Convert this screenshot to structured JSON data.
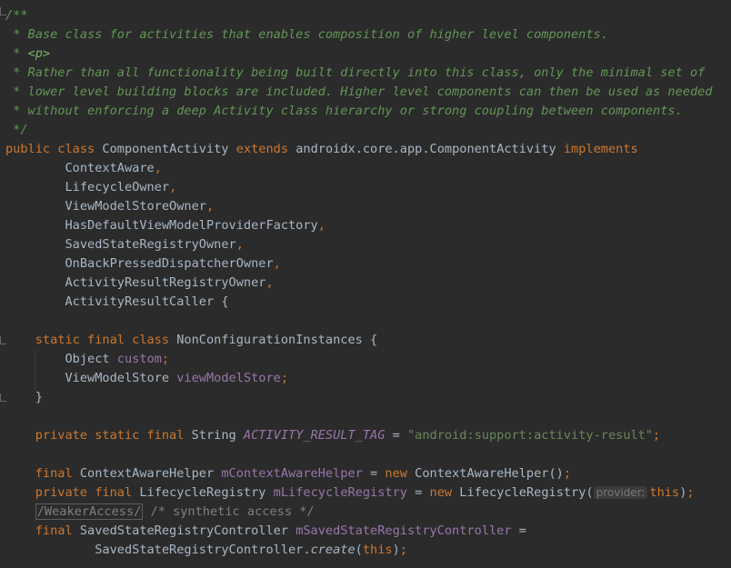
{
  "lines": [
    {
      "n": 0,
      "parts": [
        {
          "c": "doc",
          "t": "/**"
        }
      ]
    },
    {
      "n": 1,
      "parts": [
        {
          "c": "doc",
          "t": " * Base class for activities that enables composition of higher level components."
        }
      ]
    },
    {
      "n": 2,
      "parts": [
        {
          "c": "doc",
          "t": " * "
        },
        {
          "c": "doctag",
          "t": "<p>"
        }
      ]
    },
    {
      "n": 3,
      "parts": [
        {
          "c": "doc",
          "t": " * Rather than all functionality being built directly into this class, only the minimal set of"
        }
      ]
    },
    {
      "n": 4,
      "parts": [
        {
          "c": "doc",
          "t": " * lower level building blocks are included. Higher level components can then be used as needed"
        }
      ]
    },
    {
      "n": 5,
      "parts": [
        {
          "c": "doc",
          "t": " * without enforcing a deep Activity class hierarchy or strong coupling between components."
        }
      ]
    },
    {
      "n": 6,
      "parts": [
        {
          "c": "doc",
          "t": " */"
        }
      ]
    },
    {
      "n": 7,
      "parts": [
        {
          "c": "kw",
          "t": "public class "
        },
        {
          "c": "plain",
          "t": "ComponentActivity "
        },
        {
          "c": "kw",
          "t": "extends "
        },
        {
          "c": "plain",
          "t": "androidx.core.app.ComponentActivity "
        },
        {
          "c": "kw",
          "t": "implements"
        }
      ]
    },
    {
      "n": 8,
      "parts": [
        {
          "c": "plain",
          "t": "        ContextAware"
        },
        {
          "c": "kw",
          "t": ","
        }
      ]
    },
    {
      "n": 9,
      "parts": [
        {
          "c": "plain",
          "t": "        LifecycleOwner"
        },
        {
          "c": "kw",
          "t": ","
        }
      ]
    },
    {
      "n": 10,
      "parts": [
        {
          "c": "plain",
          "t": "        ViewModelStoreOwner"
        },
        {
          "c": "kw",
          "t": ","
        }
      ]
    },
    {
      "n": 11,
      "parts": [
        {
          "c": "plain",
          "t": "        HasDefaultViewModelProviderFactory"
        },
        {
          "c": "kw",
          "t": ","
        }
      ]
    },
    {
      "n": 12,
      "parts": [
        {
          "c": "plain",
          "t": "        SavedStateRegistryOwner"
        },
        {
          "c": "kw",
          "t": ","
        }
      ]
    },
    {
      "n": 13,
      "parts": [
        {
          "c": "plain",
          "t": "        OnBackPressedDispatcherOwner"
        },
        {
          "c": "kw",
          "t": ","
        }
      ]
    },
    {
      "n": 14,
      "parts": [
        {
          "c": "plain",
          "t": "        ActivityResultRegistryOwner"
        },
        {
          "c": "kw",
          "t": ","
        }
      ]
    },
    {
      "n": 15,
      "parts": [
        {
          "c": "plain",
          "t": "        ActivityResultCaller {"
        }
      ]
    },
    {
      "n": 16,
      "parts": []
    },
    {
      "n": 17,
      "parts": [
        {
          "c": "kw",
          "t": "    static final class "
        },
        {
          "c": "plain",
          "t": "NonConfigurationInstances {"
        }
      ]
    },
    {
      "n": 18,
      "parts": [
        {
          "c": "plain",
          "t": "        Object "
        },
        {
          "c": "field",
          "t": "custom"
        },
        {
          "c": "kw",
          "t": ";"
        }
      ]
    },
    {
      "n": 19,
      "parts": [
        {
          "c": "plain",
          "t": "        ViewModelStore "
        },
        {
          "c": "field",
          "t": "viewModelStore"
        },
        {
          "c": "kw",
          "t": ";"
        }
      ]
    },
    {
      "n": 20,
      "parts": [
        {
          "c": "plain",
          "t": "    }"
        }
      ]
    },
    {
      "n": 21,
      "parts": []
    },
    {
      "n": 22,
      "parts": [
        {
          "c": "kw",
          "t": "    private static final "
        },
        {
          "c": "plain",
          "t": "String "
        },
        {
          "c": "cfield",
          "t": "ACTIVITY_RESULT_TAG"
        },
        {
          "c": "plain",
          "t": " = "
        },
        {
          "c": "str",
          "t": "\"android:support:activity-result\""
        },
        {
          "c": "kw",
          "t": ";"
        }
      ]
    },
    {
      "n": 23,
      "parts": []
    },
    {
      "n": 24,
      "parts": [
        {
          "c": "kw",
          "t": "    final "
        },
        {
          "c": "plain",
          "t": "ContextAwareHelper "
        },
        {
          "c": "field",
          "t": "mContextAwareHelper"
        },
        {
          "c": "plain",
          "t": " = "
        },
        {
          "c": "kw",
          "t": "new "
        },
        {
          "c": "plain",
          "t": "ContextAwareHelper()"
        },
        {
          "c": "kw",
          "t": ";"
        }
      ]
    },
    {
      "n": 25,
      "parts": [
        {
          "c": "kw",
          "t": "    private final "
        },
        {
          "c": "plain",
          "t": "LifecycleRegistry "
        },
        {
          "c": "field",
          "t": "mLifecycleRegistry"
        },
        {
          "c": "plain",
          "t": " = "
        },
        {
          "c": "kw",
          "t": "new "
        },
        {
          "c": "plain",
          "t": "LifecycleRegistry("
        },
        {
          "c": "hint",
          "t": "provider:"
        },
        {
          "c": "kw",
          "t": "this"
        },
        {
          "c": "plain",
          "t": ")"
        },
        {
          "c": "kw",
          "t": ";"
        }
      ]
    },
    {
      "n": 26,
      "parts": [
        {
          "c": "plain",
          "t": "    "
        },
        {
          "c": "annot-box",
          "t": "/WeakerAccess/"
        },
        {
          "c": "cmt",
          "t": " /* synthetic access */"
        }
      ]
    },
    {
      "n": 27,
      "parts": [
        {
          "c": "kw",
          "t": "    final "
        },
        {
          "c": "plain",
          "t": "SavedStateRegistryController "
        },
        {
          "c": "field",
          "t": "mSavedStateRegistryController"
        },
        {
          "c": "plain",
          "t": " ="
        }
      ]
    },
    {
      "n": 28,
      "parts": [
        {
          "c": "plain",
          "t": "            SavedStateRegistryController."
        },
        {
          "c": "method",
          "t": "create"
        },
        {
          "c": "plain",
          "t": "("
        },
        {
          "c": "kw",
          "t": "this"
        },
        {
          "c": "plain",
          "t": ")"
        },
        {
          "c": "kw",
          "t": ";"
        }
      ]
    }
  ]
}
